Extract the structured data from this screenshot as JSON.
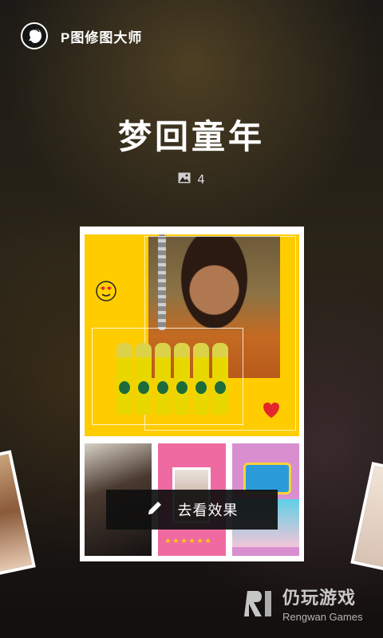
{
  "header": {
    "app_name": "P图修图大师"
  },
  "album": {
    "title": "梦回童年",
    "image_count": "4"
  },
  "cta": {
    "label": "去看效果"
  },
  "watermark": {
    "title": "仍玩游戏",
    "subtitle": "Rengwan Games"
  },
  "icons": {
    "logo": "profile-silhouette-icon",
    "count": "image-icon",
    "cta": "pencil-icon"
  },
  "colors": {
    "hero_background": "#ffcc00",
    "cta_background": "#0f0f0f"
  }
}
